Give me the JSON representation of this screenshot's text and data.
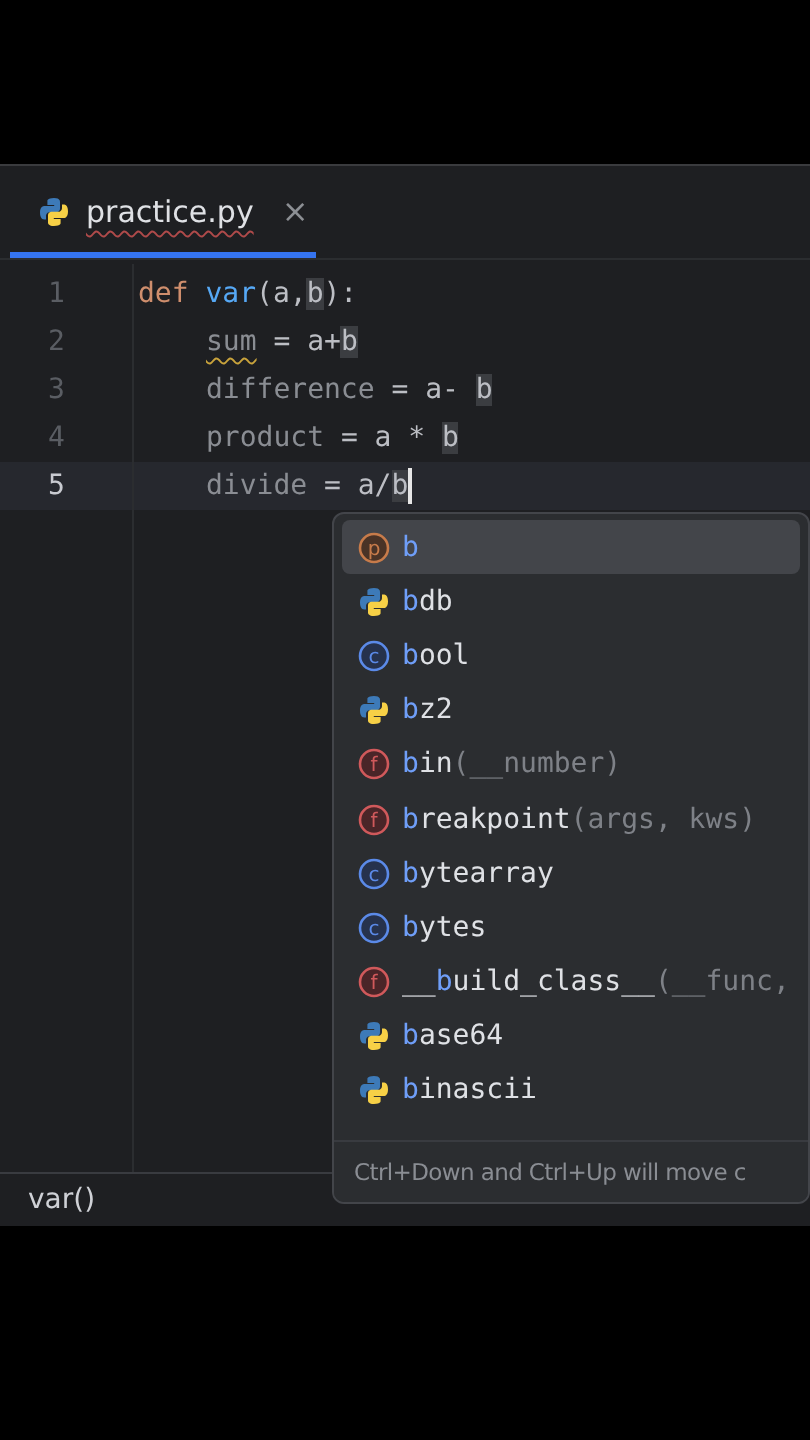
{
  "tab": {
    "label": "practice.py",
    "close": "×",
    "selected": true
  },
  "code": [
    {
      "number": "1",
      "current": false,
      "caret": false,
      "tokens": [
        {
          "t": "def ",
          "kind": "keyword"
        },
        {
          "t": "var",
          "kind": "function"
        },
        {
          "t": "(a,",
          "kind": "plain"
        },
        {
          "t": "b",
          "kind": "ref"
        },
        {
          "t": "):",
          "kind": "plain"
        }
      ],
      "children": [
        {
          "number": "2",
          "current": false,
          "caret": false,
          "tokens": [
            {
              "t": "sum",
              "kind": "warned"
            },
            {
              "t": " = a+",
              "kind": "plain"
            },
            {
              "t": "b",
              "kind": "ref"
            }
          ]
        },
        {
          "number": "3",
          "current": false,
          "caret": false,
          "tokens": [
            {
              "t": "difference",
              "kind": "unused"
            },
            {
              "t": " = a- ",
              "kind": "plain"
            },
            {
              "t": "b",
              "kind": "ref"
            }
          ]
        },
        {
          "number": "4",
          "current": false,
          "caret": false,
          "tokens": [
            {
              "t": "product",
              "kind": "unused"
            },
            {
              "t": " = a * ",
              "kind": "plain"
            },
            {
              "t": "b",
              "kind": "ref"
            }
          ]
        },
        {
          "number": "5",
          "current": true,
          "caret": true,
          "tokens": [
            {
              "t": "divide",
              "kind": "unused"
            },
            {
              "t": " = a/",
              "kind": "plain"
            },
            {
              "t": "b",
              "kind": "ref"
            }
          ]
        }
      ]
    }
  ],
  "completion": {
    "items": [
      {
        "kind": "parameter",
        "icon": "p",
        "match": "b",
        "selected": true
      },
      {
        "kind": "module",
        "match": "b",
        "rest": "db",
        "selected": false
      },
      {
        "kind": "class",
        "icon": "c",
        "match": "b",
        "rest": "ool",
        "selected": false
      },
      {
        "kind": "module",
        "match": "b",
        "rest": "z2",
        "selected": false
      },
      {
        "kind": "function",
        "icon": "f",
        "match": "b",
        "rest": "in",
        "args": "(__number)",
        "selected": false
      },
      {
        "kind": "function",
        "icon": "f",
        "match": "b",
        "rest": "reakpoint",
        "args": "(args, kws)",
        "selected": false
      },
      {
        "kind": "class",
        "icon": "c",
        "match": "b",
        "rest": "ytearray",
        "selected": false
      },
      {
        "kind": "class",
        "icon": "c",
        "match": "b",
        "rest": "ytes",
        "selected": false
      },
      {
        "kind": "function",
        "icon": "f",
        "pre": "__",
        "match": "b",
        "rest": "uild_class__",
        "args": "(__func,",
        "selected": false
      },
      {
        "kind": "module",
        "match": "b",
        "rest": "ase64",
        "selected": false
      },
      {
        "kind": "module",
        "match": "b",
        "rest": "inascii",
        "selected": false
      }
    ],
    "hint": "Ctrl+Down and Ctrl+Up will move c"
  },
  "status_bar": {
    "breadcrumb": "var()"
  }
}
